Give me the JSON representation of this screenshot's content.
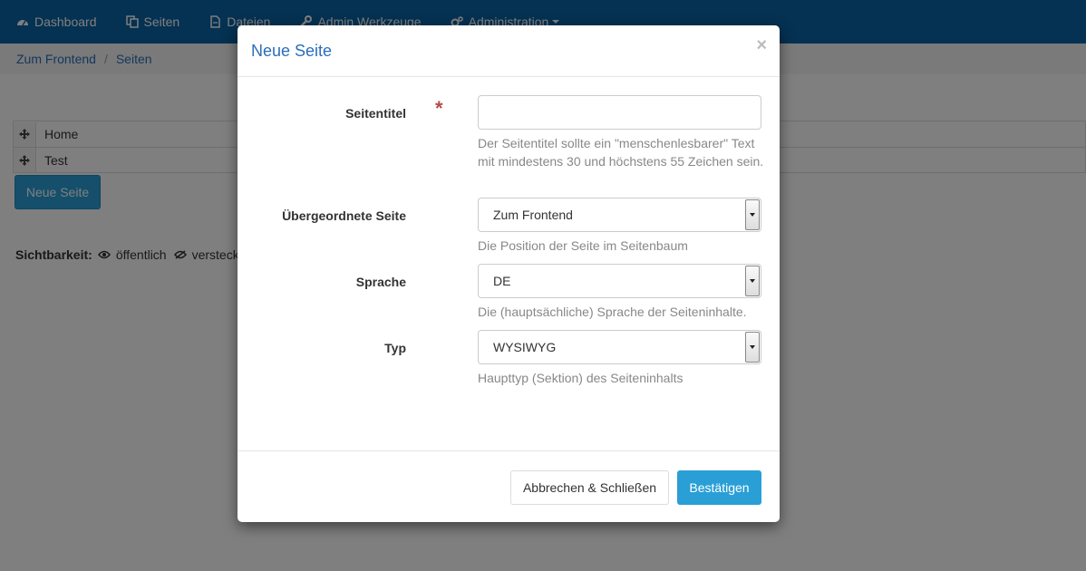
{
  "nav": {
    "items": [
      {
        "label": "Dashboard",
        "icon": "dashboard-icon"
      },
      {
        "label": "Seiten",
        "icon": "pages-icon"
      },
      {
        "label": "Dateien",
        "icon": "file-icon"
      },
      {
        "label": "Admin Werkzeuge",
        "icon": "wrench-icon"
      },
      {
        "label": "Administration",
        "icon": "gears-icon"
      }
    ]
  },
  "breadcrumb": {
    "items": [
      "Zum Frontend",
      "Seiten"
    ],
    "separator": "/"
  },
  "pages": {
    "rows": [
      {
        "label": "Home"
      },
      {
        "label": "Test"
      }
    ],
    "new_button": "Neue Seite"
  },
  "visibility": {
    "label": "Sichtbarkeit:",
    "public": "öffentlich",
    "hidden": "versteck"
  },
  "modal": {
    "title": "Neue Seite",
    "close": "×",
    "fields": {
      "title": {
        "label": "Seitentitel",
        "required": "*",
        "value": "",
        "help": "Der Seitentitel sollte ein \"menschenlesbarer\" Text mit mindestens 30 und höchstens 55 Zeichen sein."
      },
      "parent": {
        "label": "Übergeordnete Seite",
        "value": "Zum Frontend",
        "help": "Die Position der Seite im Seitenbaum"
      },
      "language": {
        "label": "Sprache",
        "value": "DE",
        "help": "Die (hauptsächliche) Sprache der Seiteninhalte."
      },
      "type": {
        "label": "Typ",
        "value": "WYSIWYG",
        "help": "Haupttyp (Sektion) des Seiteninhalts"
      }
    },
    "buttons": {
      "cancel": "Abbrechen & Schließen",
      "confirm": "Bestätigen"
    }
  },
  "colors": {
    "navbar": "#0b62a4",
    "accent": "#2a9fd6",
    "link": "#2a6ebb",
    "required": "#b94a48"
  }
}
